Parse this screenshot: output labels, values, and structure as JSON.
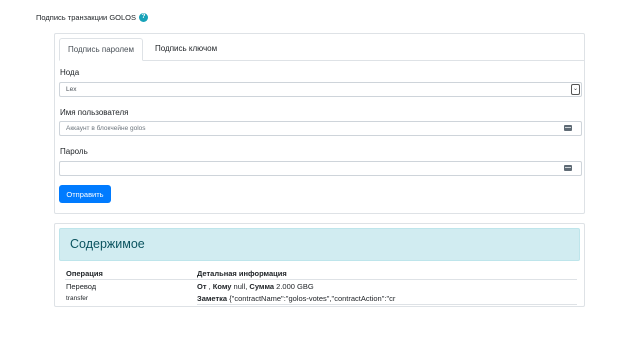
{
  "page": {
    "title": "Подпись транзакции GOLOS",
    "help_icon": "?"
  },
  "tabs": [
    {
      "label": "Подпись паролем",
      "active": true
    },
    {
      "label": "Подпись ключом",
      "active": false
    }
  ],
  "form": {
    "node": {
      "label": "Нода",
      "value": "Lex",
      "arrow": "⌄"
    },
    "username": {
      "label": "Имя пользователя",
      "placeholder": "Аккаунт в блокчейне golos"
    },
    "password": {
      "label": "Пароль",
      "value": ""
    },
    "submit_label": "Отправить"
  },
  "content": {
    "title": "Содержимое",
    "columns": [
      "Операция",
      "Детальная информация"
    ],
    "operation_label": "Перевод",
    "operation_code": "transfer",
    "details_line1": {
      "from_label": "От",
      "sep1": " , ",
      "to_label": "Кому",
      "to_value": " null, ",
      "amount_label": "Сумма",
      "amount_value": " 2.000 GBG"
    },
    "details_line2": {
      "memo_label": "Заметка",
      "memo_value": " {\"contractName\":\"golos-votes\",\"contractAction\":\"cr"
    }
  },
  "colors": {
    "primary": "#007bff",
    "info_bg": "#d1ecf1",
    "info_text": "#0c5460",
    "help": "#17a2b8"
  }
}
